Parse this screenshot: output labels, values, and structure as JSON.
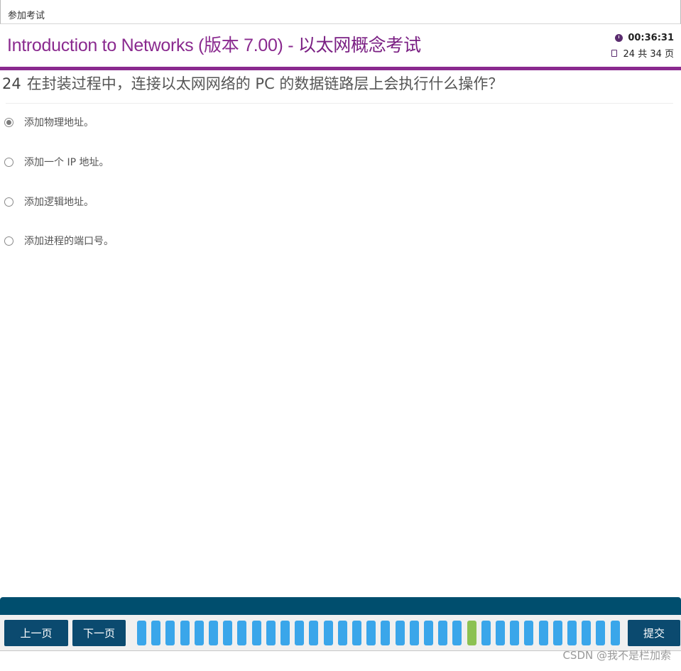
{
  "window": {
    "title": "参加考试"
  },
  "header": {
    "exam_title_prefix": "Introduction to Networks (版本 7.00) - ",
    "exam_title_suffix": "以太网概念考试",
    "timer": "00:36:31",
    "page_indicator": "24 共 34 页"
  },
  "question": {
    "number": "24",
    "text": "在封装过程中，连接以太网网络的 PC 的数据链路层上会执行什么操作？"
  },
  "options": [
    {
      "label": "添加物理地址。",
      "checked": true
    },
    {
      "label": "添加一个 IP 地址。",
      "checked": false
    },
    {
      "label": "添加逻辑地址。",
      "checked": false
    },
    {
      "label": "添加进程的端口号。",
      "checked": false
    }
  ],
  "nav": {
    "prev_label": "上一页",
    "next_label": "下一页",
    "submit_label": "提交",
    "total_questions": 34,
    "current_question": 24
  },
  "colors": {
    "brand_purple": "#8a2a8f",
    "nav_dark": "#0b4a6f",
    "question_dot": "#3aa6ea",
    "current_dot": "#8cc152"
  },
  "watermark": "CSDN @我不是栏加索"
}
